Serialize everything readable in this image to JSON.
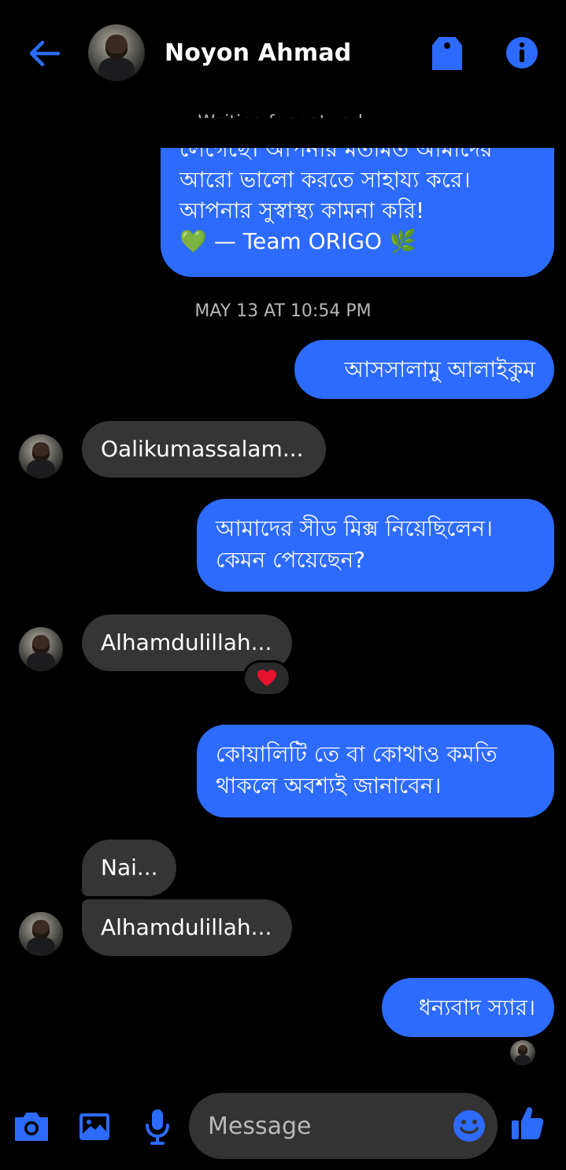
{
  "header": {
    "contact_name": "Noyon Ahmad",
    "network_status": "Waiting for network"
  },
  "colors": {
    "accent": "#2d6bff",
    "incoming_bubble": "#353535",
    "background": "#000000"
  },
  "messages": {
    "partial_top": {
      "line1": "লেগেছে। আপনার মতামত আমাদের",
      "line2": "আরো ভালো করতে সাহায্য করে।",
      "line3": "আপনার সুস্বাস্থ্য কামনা করি!",
      "line4_heart": "💚",
      "line4_text": " — Team ORIGO ",
      "line4_leaf": "🌿"
    },
    "timestamp": "MAY 13 AT 10:54 PM",
    "out_1": "আসসালামু আলাইকুম",
    "in_1": "Oalikumassalam...",
    "out_2_line1": "আমাদের সীড মিক্স নিয়েছিলেন।",
    "out_2_line2": "কেমন পেয়েছেন?",
    "in_2": "Alhamdulillah...",
    "in_2_reaction": "❤️",
    "out_3_line1": "কোয়ালিটি তে বা কোথাও কমতি",
    "out_3_line2": "থাকলে অবশ্যই জানাবেন।",
    "in_3": "Nai...",
    "in_4": "Alhamdulillah...",
    "out_4": "ধন্যবাদ স্যার।"
  },
  "composer": {
    "placeholder": "Message"
  },
  "icons": [
    "back-arrow-icon",
    "tag-icon",
    "info-icon",
    "camera-icon",
    "image-icon",
    "microphone-icon",
    "emoji-icon",
    "thumbs-up-icon"
  ]
}
